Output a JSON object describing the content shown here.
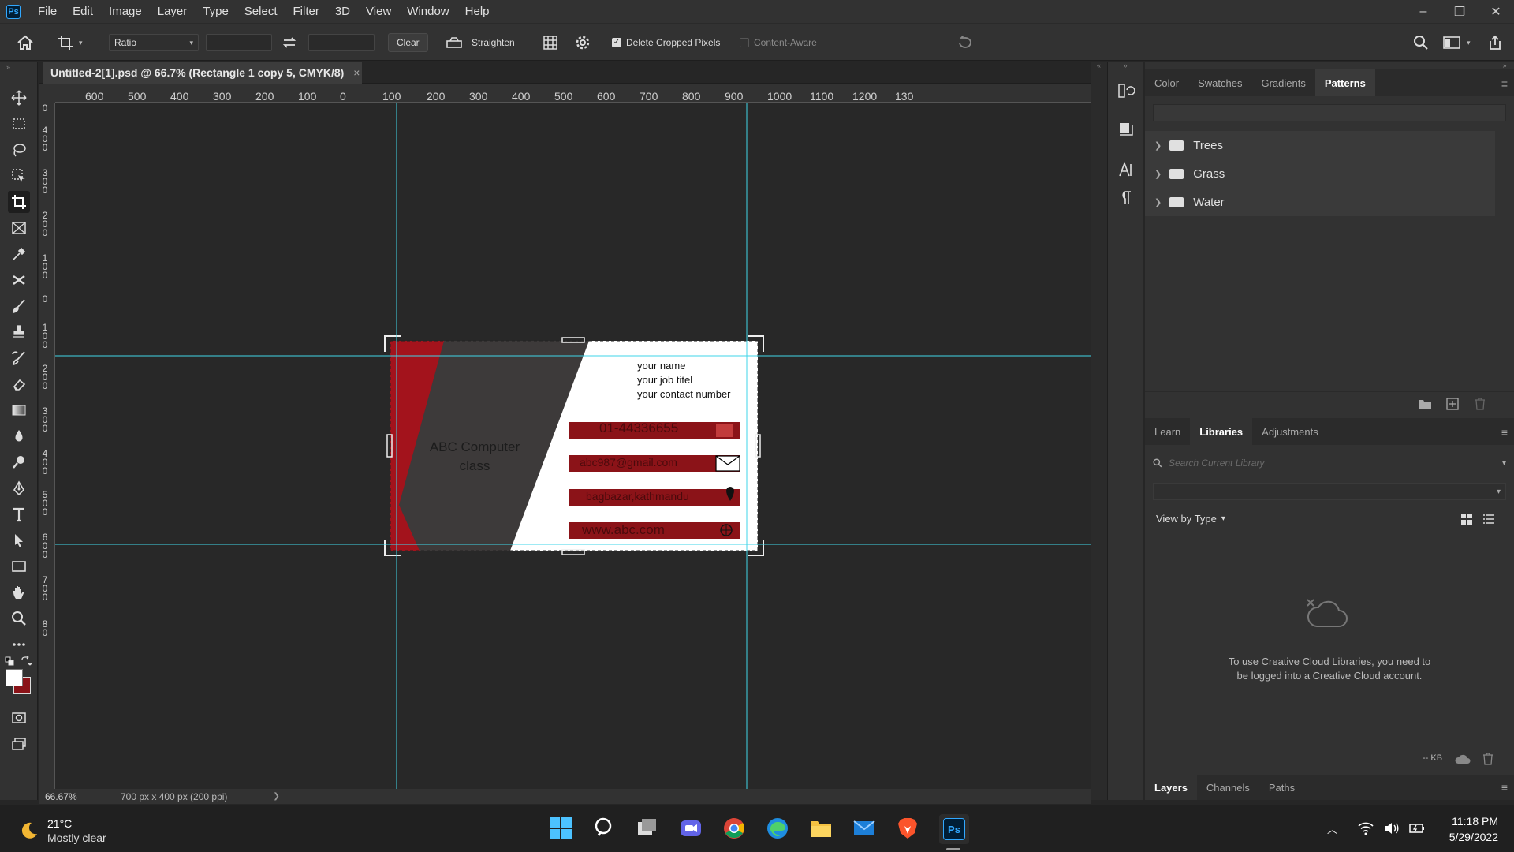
{
  "app": {
    "logo": "Ps"
  },
  "menubar": {
    "items": [
      "File",
      "Edit",
      "Image",
      "Layer",
      "Type",
      "Select",
      "Filter",
      "3D",
      "View",
      "Window",
      "Help"
    ]
  },
  "window_controls": {
    "minimize": "–",
    "restore": "❐",
    "close": "✕"
  },
  "options_bar": {
    "ratio_label": "Ratio",
    "width_value": "",
    "height_value": "",
    "clear_label": "Clear",
    "straighten_label": "Straighten",
    "delete_cropped_label": "Delete Cropped Pixels",
    "delete_cropped_checked": true,
    "content_aware_label": "Content-Aware",
    "content_aware_checked": false
  },
  "document": {
    "tab_title": "Untitled-2[1].psd @ 66.7% (Rectangle 1 copy 5, CMYK/8)",
    "close": "×",
    "zoom": "66.67%",
    "doc_info": "700 px x 400 px (200 ppi)",
    "status_arrow": "❯"
  },
  "ruler": {
    "h_ticks": [
      "600",
      "500",
      "400",
      "300",
      "200",
      "100",
      "0",
      "100",
      "200",
      "300",
      "400",
      "500",
      "600",
      "700",
      "800",
      "900",
      "1000",
      "1100",
      "1200",
      "130"
    ],
    "v_ticks": [
      [
        "0"
      ],
      [
        "4",
        "0",
        "0"
      ],
      [
        "3",
        "0",
        "0"
      ],
      [
        "2",
        "0",
        "0"
      ],
      [
        "1",
        "0",
        "0"
      ],
      [
        "0"
      ],
      [
        "1",
        "0",
        "0"
      ],
      [
        "2",
        "0",
        "0"
      ],
      [
        "3",
        "0",
        "0"
      ],
      [
        "4",
        "0",
        "0"
      ],
      [
        "5",
        "0",
        "0"
      ],
      [
        "6",
        "0",
        "0"
      ],
      [
        "7",
        "0",
        "0"
      ],
      [
        "8",
        "0"
      ]
    ]
  },
  "card": {
    "company_line1": "ABC Computer",
    "company_line2": "class",
    "name": "your name",
    "job": "your job titel",
    "contact": "your contact number",
    "phone": "01-44336655",
    "email": "abc987@gmail.com",
    "address": "bagbazar,kathmandu",
    "website": "www.abc.com",
    "colors": {
      "red": "#8b1318",
      "bright_red": "#a3131c",
      "gray": "#3d3a3a",
      "white": "#ffffff",
      "guide": "#3fd6e8"
    }
  },
  "patterns_panel": {
    "tabs": [
      "Color",
      "Swatches",
      "Gradients",
      "Patterns"
    ],
    "active_tab": "Patterns",
    "folders": [
      "Trees",
      "Grass",
      "Water"
    ]
  },
  "libraries_panel": {
    "tabs": [
      "Learn",
      "Libraries",
      "Adjustments"
    ],
    "active_tab": "Libraries",
    "search_placeholder": "Search Current Library",
    "view_by": "View by Type",
    "message": "To use Creative Cloud Libraries, you need to be logged into a Creative Cloud account.",
    "kb": "-- KB"
  },
  "layers_panel": {
    "tabs": [
      "Layers",
      "Channels",
      "Paths"
    ],
    "active_tab": "Layers"
  },
  "taskbar": {
    "weather_temp": "21°C",
    "weather_desc": "Mostly clear",
    "time": "11:18 PM",
    "date": "5/29/2022"
  }
}
